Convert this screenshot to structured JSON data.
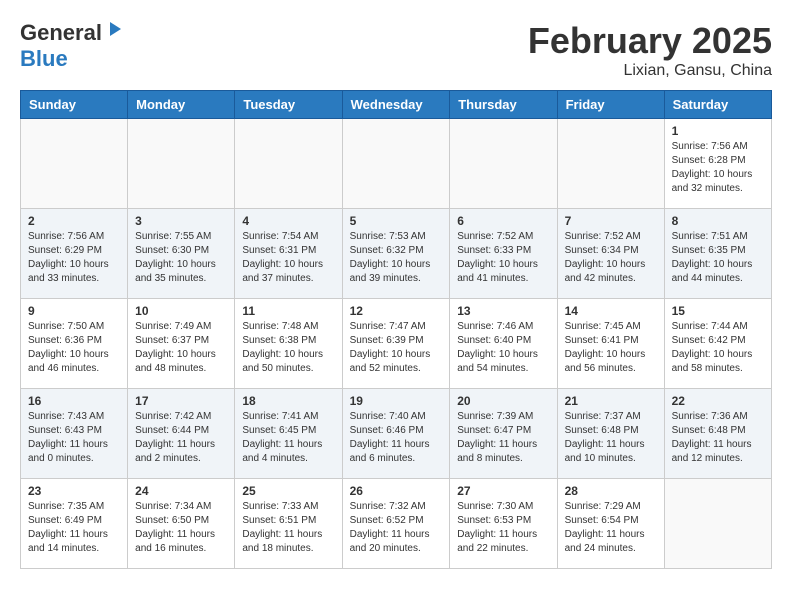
{
  "header": {
    "logo_general": "General",
    "logo_blue": "Blue",
    "title": "February 2025",
    "subtitle": "Lixian, Gansu, China"
  },
  "weekdays": [
    "Sunday",
    "Monday",
    "Tuesday",
    "Wednesday",
    "Thursday",
    "Friday",
    "Saturday"
  ],
  "weeks": [
    [
      {
        "day": "",
        "info": ""
      },
      {
        "day": "",
        "info": ""
      },
      {
        "day": "",
        "info": ""
      },
      {
        "day": "",
        "info": ""
      },
      {
        "day": "",
        "info": ""
      },
      {
        "day": "",
        "info": ""
      },
      {
        "day": "1",
        "info": "Sunrise: 7:56 AM\nSunset: 6:28 PM\nDaylight: 10 hours and 32 minutes."
      }
    ],
    [
      {
        "day": "2",
        "info": "Sunrise: 7:56 AM\nSunset: 6:29 PM\nDaylight: 10 hours and 33 minutes."
      },
      {
        "day": "3",
        "info": "Sunrise: 7:55 AM\nSunset: 6:30 PM\nDaylight: 10 hours and 35 minutes."
      },
      {
        "day": "4",
        "info": "Sunrise: 7:54 AM\nSunset: 6:31 PM\nDaylight: 10 hours and 37 minutes."
      },
      {
        "day": "5",
        "info": "Sunrise: 7:53 AM\nSunset: 6:32 PM\nDaylight: 10 hours and 39 minutes."
      },
      {
        "day": "6",
        "info": "Sunrise: 7:52 AM\nSunset: 6:33 PM\nDaylight: 10 hours and 41 minutes."
      },
      {
        "day": "7",
        "info": "Sunrise: 7:52 AM\nSunset: 6:34 PM\nDaylight: 10 hours and 42 minutes."
      },
      {
        "day": "8",
        "info": "Sunrise: 7:51 AM\nSunset: 6:35 PM\nDaylight: 10 hours and 44 minutes."
      }
    ],
    [
      {
        "day": "9",
        "info": "Sunrise: 7:50 AM\nSunset: 6:36 PM\nDaylight: 10 hours and 46 minutes."
      },
      {
        "day": "10",
        "info": "Sunrise: 7:49 AM\nSunset: 6:37 PM\nDaylight: 10 hours and 48 minutes."
      },
      {
        "day": "11",
        "info": "Sunrise: 7:48 AM\nSunset: 6:38 PM\nDaylight: 10 hours and 50 minutes."
      },
      {
        "day": "12",
        "info": "Sunrise: 7:47 AM\nSunset: 6:39 PM\nDaylight: 10 hours and 52 minutes."
      },
      {
        "day": "13",
        "info": "Sunrise: 7:46 AM\nSunset: 6:40 PM\nDaylight: 10 hours and 54 minutes."
      },
      {
        "day": "14",
        "info": "Sunrise: 7:45 AM\nSunset: 6:41 PM\nDaylight: 10 hours and 56 minutes."
      },
      {
        "day": "15",
        "info": "Sunrise: 7:44 AM\nSunset: 6:42 PM\nDaylight: 10 hours and 58 minutes."
      }
    ],
    [
      {
        "day": "16",
        "info": "Sunrise: 7:43 AM\nSunset: 6:43 PM\nDaylight: 11 hours and 0 minutes."
      },
      {
        "day": "17",
        "info": "Sunrise: 7:42 AM\nSunset: 6:44 PM\nDaylight: 11 hours and 2 minutes."
      },
      {
        "day": "18",
        "info": "Sunrise: 7:41 AM\nSunset: 6:45 PM\nDaylight: 11 hours and 4 minutes."
      },
      {
        "day": "19",
        "info": "Sunrise: 7:40 AM\nSunset: 6:46 PM\nDaylight: 11 hours and 6 minutes."
      },
      {
        "day": "20",
        "info": "Sunrise: 7:39 AM\nSunset: 6:47 PM\nDaylight: 11 hours and 8 minutes."
      },
      {
        "day": "21",
        "info": "Sunrise: 7:37 AM\nSunset: 6:48 PM\nDaylight: 11 hours and 10 minutes."
      },
      {
        "day": "22",
        "info": "Sunrise: 7:36 AM\nSunset: 6:48 PM\nDaylight: 11 hours and 12 minutes."
      }
    ],
    [
      {
        "day": "23",
        "info": "Sunrise: 7:35 AM\nSunset: 6:49 PM\nDaylight: 11 hours and 14 minutes."
      },
      {
        "day": "24",
        "info": "Sunrise: 7:34 AM\nSunset: 6:50 PM\nDaylight: 11 hours and 16 minutes."
      },
      {
        "day": "25",
        "info": "Sunrise: 7:33 AM\nSunset: 6:51 PM\nDaylight: 11 hours and 18 minutes."
      },
      {
        "day": "26",
        "info": "Sunrise: 7:32 AM\nSunset: 6:52 PM\nDaylight: 11 hours and 20 minutes."
      },
      {
        "day": "27",
        "info": "Sunrise: 7:30 AM\nSunset: 6:53 PM\nDaylight: 11 hours and 22 minutes."
      },
      {
        "day": "28",
        "info": "Sunrise: 7:29 AM\nSunset: 6:54 PM\nDaylight: 11 hours and 24 minutes."
      },
      {
        "day": "",
        "info": ""
      }
    ]
  ]
}
